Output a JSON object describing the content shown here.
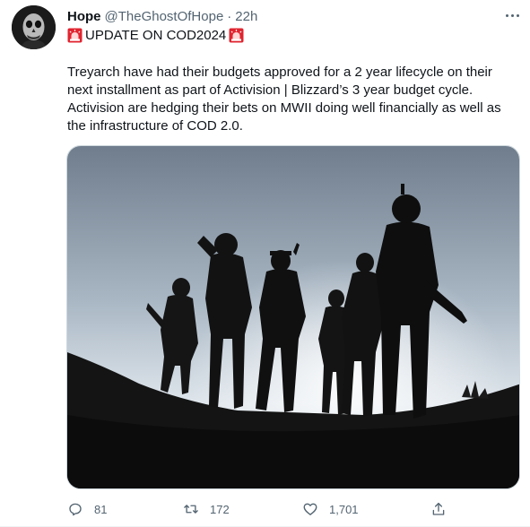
{
  "tweet": {
    "author_name": "Hope",
    "author_handle": "@TheGhostOfHope",
    "separator": "·",
    "time": "22h",
    "headline": "UPDATE ON COD2024",
    "text": "Treyarch have had their budgets approved for a 2 year lifecycle on their next installment as part of Activision | Blizzard’s 3 year budget cycle. Activision are hedging their bets on MWII doing well financially as well as the infrastructure of COD 2.0.",
    "media_description": "silhouettes of soldiers on a hill against the sky",
    "stats": {
      "replies": "81",
      "retweets": "172",
      "likes": "1,701"
    }
  },
  "icons": {
    "more": "more-horizontal-icon",
    "siren": "police-light-icon",
    "reply": "reply-icon",
    "retweet": "retweet-icon",
    "like": "heart-icon",
    "share": "share-icon"
  },
  "colors": {
    "text_primary": "#0f1419",
    "text_secondary": "#536471",
    "siren_red": "#e0242f",
    "border": "#cfd9de"
  }
}
